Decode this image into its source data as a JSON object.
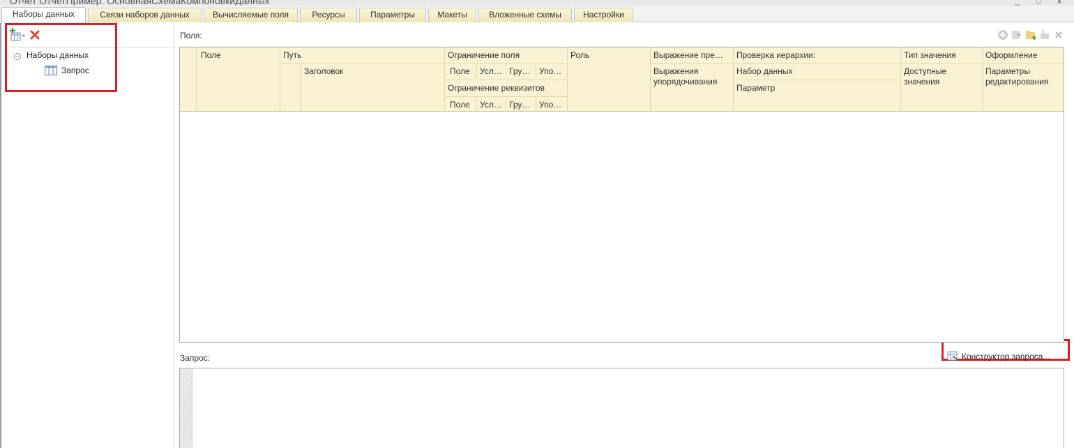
{
  "window": {
    "title": "Отчет ОтчетПример: ОсновнаяСхемаКомпоновкиДанных",
    "controls": "_ □ x"
  },
  "tabs": [
    {
      "label": "Наборы данных"
    },
    {
      "label": "Связи наборов данных"
    },
    {
      "label": "Вычисляемые поля"
    },
    {
      "label": "Ресурсы"
    },
    {
      "label": "Параметры"
    },
    {
      "label": "Макеты"
    },
    {
      "label": "Вложенные схемы"
    },
    {
      "label": "Настройки"
    }
  ],
  "active_tab": "Наборы данных",
  "tree": {
    "root": "Наборы данных",
    "toggle": "⊖",
    "child": "Запрос"
  },
  "fields_label": "Поля:",
  "grid_header": {
    "pole": "Поле",
    "put": "Путь",
    "zagolovok": "Заголовок",
    "ogr_polya": "Ограничение поля",
    "ogr_sub": [
      "Поле",
      "Усл…",
      "Гру…",
      "Упо…"
    ],
    "ogr_rekv": "Ограничение реквизитов",
    "ogr_rekv_sub": [
      "Поле",
      "Усл…",
      "Гру…",
      "Упо…"
    ],
    "rol": "Роль",
    "vyrazh_pre": "Выражение пре…",
    "vyrazh_upor_1": "Выражения",
    "vyrazh_upor_2": "упорядочивания",
    "proverka": "Проверка иерархии:",
    "nabor": "Набор данных",
    "parametr": "Параметр",
    "tip": "Тип значения",
    "dostupnye_1": "Доступные",
    "dostupnye_2": "значения",
    "oform": "Оформление",
    "param_red_1": "Параметры",
    "param_red_2": "редактирования"
  },
  "query_label": "Запрос:",
  "constructor_button": "Конструктор запроса...",
  "icons": {
    "add": "add-dataset-icon",
    "delete": "delete-icon",
    "table": "table-icon"
  },
  "colors": {
    "highlight_box": "#e01b24",
    "header_bg": "#f9f3d3",
    "tab_bg": "#efe6b8"
  }
}
